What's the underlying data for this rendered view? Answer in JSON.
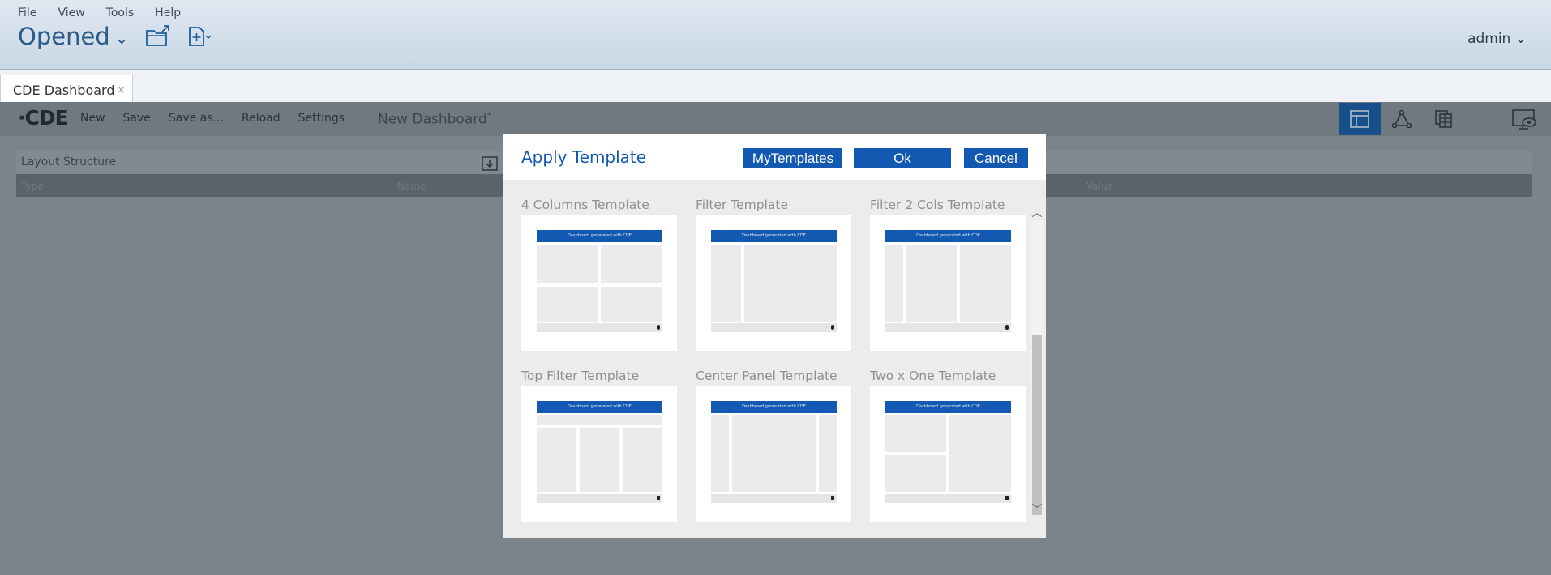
{
  "menu": {
    "file": "File",
    "view": "View",
    "tools": "Tools",
    "help": "Help"
  },
  "header": {
    "opened_label": "Opened",
    "user": "admin"
  },
  "tabs": [
    {
      "label": "CDE Dashboard",
      "close": "×"
    }
  ],
  "cde_toolbar": {
    "logo": "·CDE",
    "new": "New",
    "save": "Save",
    "save_as": "Save as...",
    "reload": "Reload",
    "settings": "Settings",
    "dashboard_title": "New Dashboard",
    "dirty_marker": "*"
  },
  "layout_panel": {
    "title": "Layout Structure",
    "columns": {
      "type": "Type",
      "name": "Name",
      "value": "Value"
    }
  },
  "dialog": {
    "title": "Apply Template",
    "mytemplates_label": "MyTemplates",
    "ok_label": "Ok",
    "cancel_label": "Cancel",
    "thumbnail_header": "Dashboard generated with CDE",
    "templates": [
      {
        "name": "4 Columns Template"
      },
      {
        "name": "Filter Template"
      },
      {
        "name": "Filter 2 Cols Template"
      },
      {
        "name": "Top Filter Template"
      },
      {
        "name": "Center Panel Template"
      },
      {
        "name": "Two x One Template"
      }
    ]
  },
  "colors": {
    "accent": "#1359b1",
    "active_view": "#164f8a",
    "overlay": "#7b848a"
  }
}
